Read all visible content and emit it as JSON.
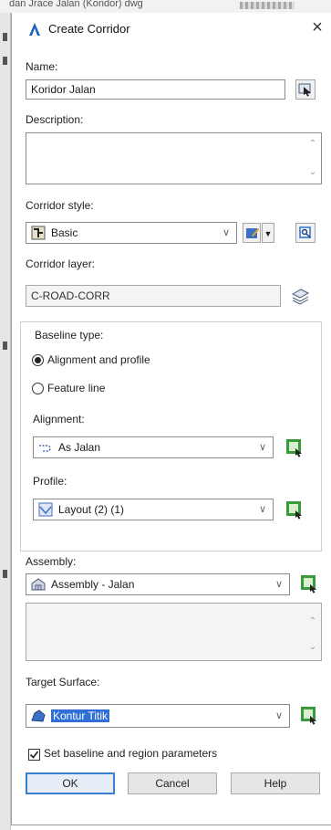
{
  "background_title": "dan Jrace Jalan (Kondor) dwg",
  "dialog": {
    "title": "Create Corridor",
    "close_glyph": "×",
    "name": {
      "label": "Name:",
      "value": "Koridor Jalan"
    },
    "description": {
      "label": "Description:",
      "value": ""
    },
    "corridor_style": {
      "label": "Corridor style:",
      "value": "Basic"
    },
    "corridor_layer": {
      "label": "Corridor layer:",
      "value": "C-ROAD-CORR"
    },
    "baseline": {
      "group_label": "Baseline type:",
      "options": [
        {
          "label": "Alignment and profile",
          "selected": true
        },
        {
          "label": "Feature line",
          "selected": false
        }
      ],
      "alignment": {
        "label": "Alignment:",
        "value": "As Jalan"
      },
      "profile": {
        "label": "Profile:",
        "value": "Layout (2) (1)"
      }
    },
    "assembly": {
      "label": "Assembly:",
      "value": "Assembly - Jalan"
    },
    "target_surface": {
      "label": "Target Surface:",
      "value": "Kontur Titik"
    },
    "set_baseline_checkbox": {
      "label": "Set baseline and region parameters",
      "checked": true
    },
    "buttons": {
      "ok": "OK",
      "cancel": "Cancel",
      "help": "Help"
    }
  },
  "icons": {
    "app": "civil3d-logo-icon",
    "pick_from_drawing": "pick-from-drawing-icon",
    "edit_style": "edit-style-icon",
    "layer": "layer-icon",
    "select_from_drawing": "select-from-drawing-icon"
  },
  "colors": {
    "accent": "#2f6fd6",
    "icon_green": "#3a9a3a",
    "title_blue": "#1f5fbf"
  },
  "scroll_arrows": {
    "up": "⌃",
    "down": "⌄"
  },
  "dropdown_glyph": "∨"
}
